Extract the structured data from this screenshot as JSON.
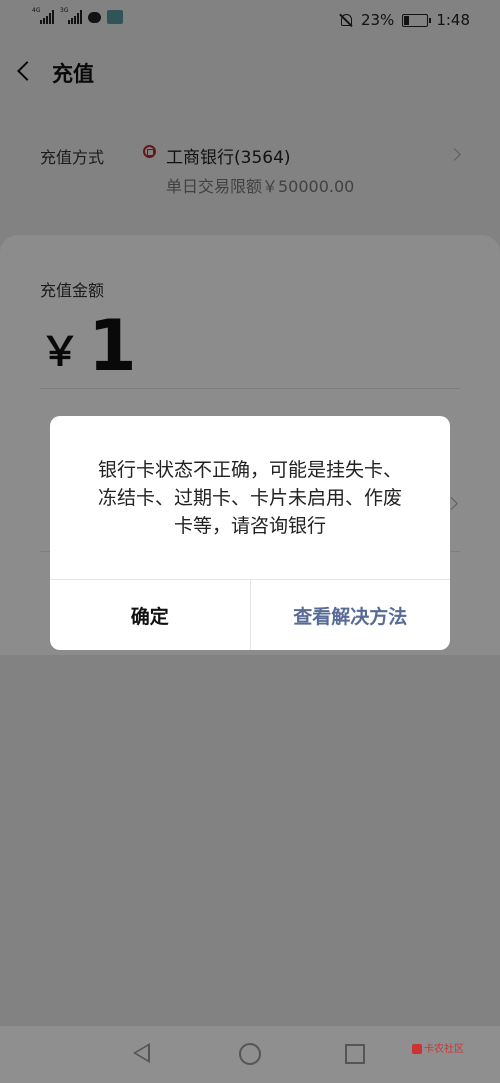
{
  "status_bar": {
    "signal_1_network": "4G",
    "signal_2_network": "3G",
    "app_badge_icon": "gov-app-icon",
    "battery_percent": "23%",
    "time": "1:48"
  },
  "nav": {
    "title": "充值"
  },
  "payment_method": {
    "label": "充值方式",
    "bank_name": "工商银行(3564)",
    "limit_text": "单日交易限额￥50000.00"
  },
  "amount": {
    "label": "充值金额",
    "currency_symbol": "￥",
    "value": "1"
  },
  "dialog": {
    "message": "银行卡状态不正确，可能是挂失卡、冻结卡、过期卡、卡片未启用、作废卡等，请咨询银行",
    "confirm_label": "确定",
    "solution_label": "查看解决方法"
  },
  "watermark": {
    "text": "卡农社区"
  },
  "colors": {
    "dialog_link": "#576b95",
    "icbc_red": "#c1272d"
  }
}
